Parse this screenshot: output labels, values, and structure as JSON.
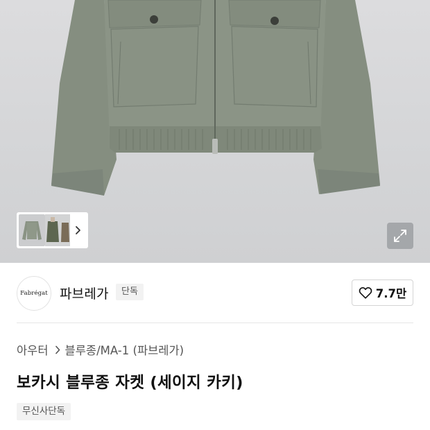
{
  "gallery": {
    "image_alt": "product-photo-khaki-bomber-jacket",
    "thumbnails": [
      "jacket-front",
      "jacket-model",
      "jacket-side"
    ],
    "next_icon": "chevron-right-icon",
    "expand_icon": "expand-icon"
  },
  "brand": {
    "logo_text": "Fabrégat",
    "name": "파브레가",
    "badge": "단독",
    "like_count": "7.7만",
    "like_icon": "heart-outline-icon"
  },
  "breadcrumb": {
    "level1": "아우터",
    "level2": "블루종/MA-1 (파브레가)"
  },
  "product": {
    "title": "보카시 블루종 자켓 (세이지 카키)",
    "tag": "무신사단독"
  },
  "colors": {
    "jacket": "#8a9384",
    "background": "#d6d7d9"
  }
}
